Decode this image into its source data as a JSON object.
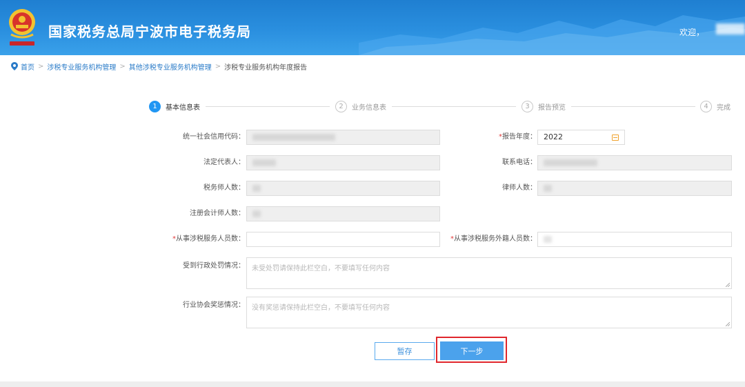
{
  "header": {
    "title": "国家税务总局宁波市电子税务局",
    "welcome": "欢迎，"
  },
  "breadcrumb": {
    "items": [
      "首页",
      "涉税专业服务机构管理",
      "其他涉税专业服务机构管理"
    ],
    "current": "涉税专业服务机构年度报告"
  },
  "steps": [
    {
      "num": "1",
      "label": "基本信息表"
    },
    {
      "num": "2",
      "label": "业务信息表"
    },
    {
      "num": "3",
      "label": "报告预览"
    },
    {
      "num": "4",
      "label": "完成"
    }
  ],
  "form": {
    "credit_code_label": "统一社会信用代码：",
    "report_year_label": "报告年度：",
    "report_year_value": "2022",
    "legal_rep_label": "法定代表人：",
    "phone_label": "联系电话：",
    "tax_agent_count_label": "税务师人数：",
    "lawyer_count_label": "律师人数：",
    "cpa_count_label": "注册会计师人数：",
    "staff_count_label": "从事涉税服务人员数：",
    "foreign_staff_count_label": "从事涉税服务外籍人员数：",
    "penalty_label": "受到行政处罚情况：",
    "penalty_placeholder": "未受处罚请保持此栏空白，不要填写任何内容",
    "award_label": "行业协会奖惩情况：",
    "award_placeholder": "没有奖惩请保持此栏空白，不要填写任何内容",
    "required_mark": "*"
  },
  "buttons": {
    "save": "暂存",
    "next": "下一步"
  },
  "colors": {
    "header_blue": "#2a8fdf",
    "accent": "#2196f3",
    "highlight_red": "#e0262c",
    "required_red": "#e03a3a"
  }
}
